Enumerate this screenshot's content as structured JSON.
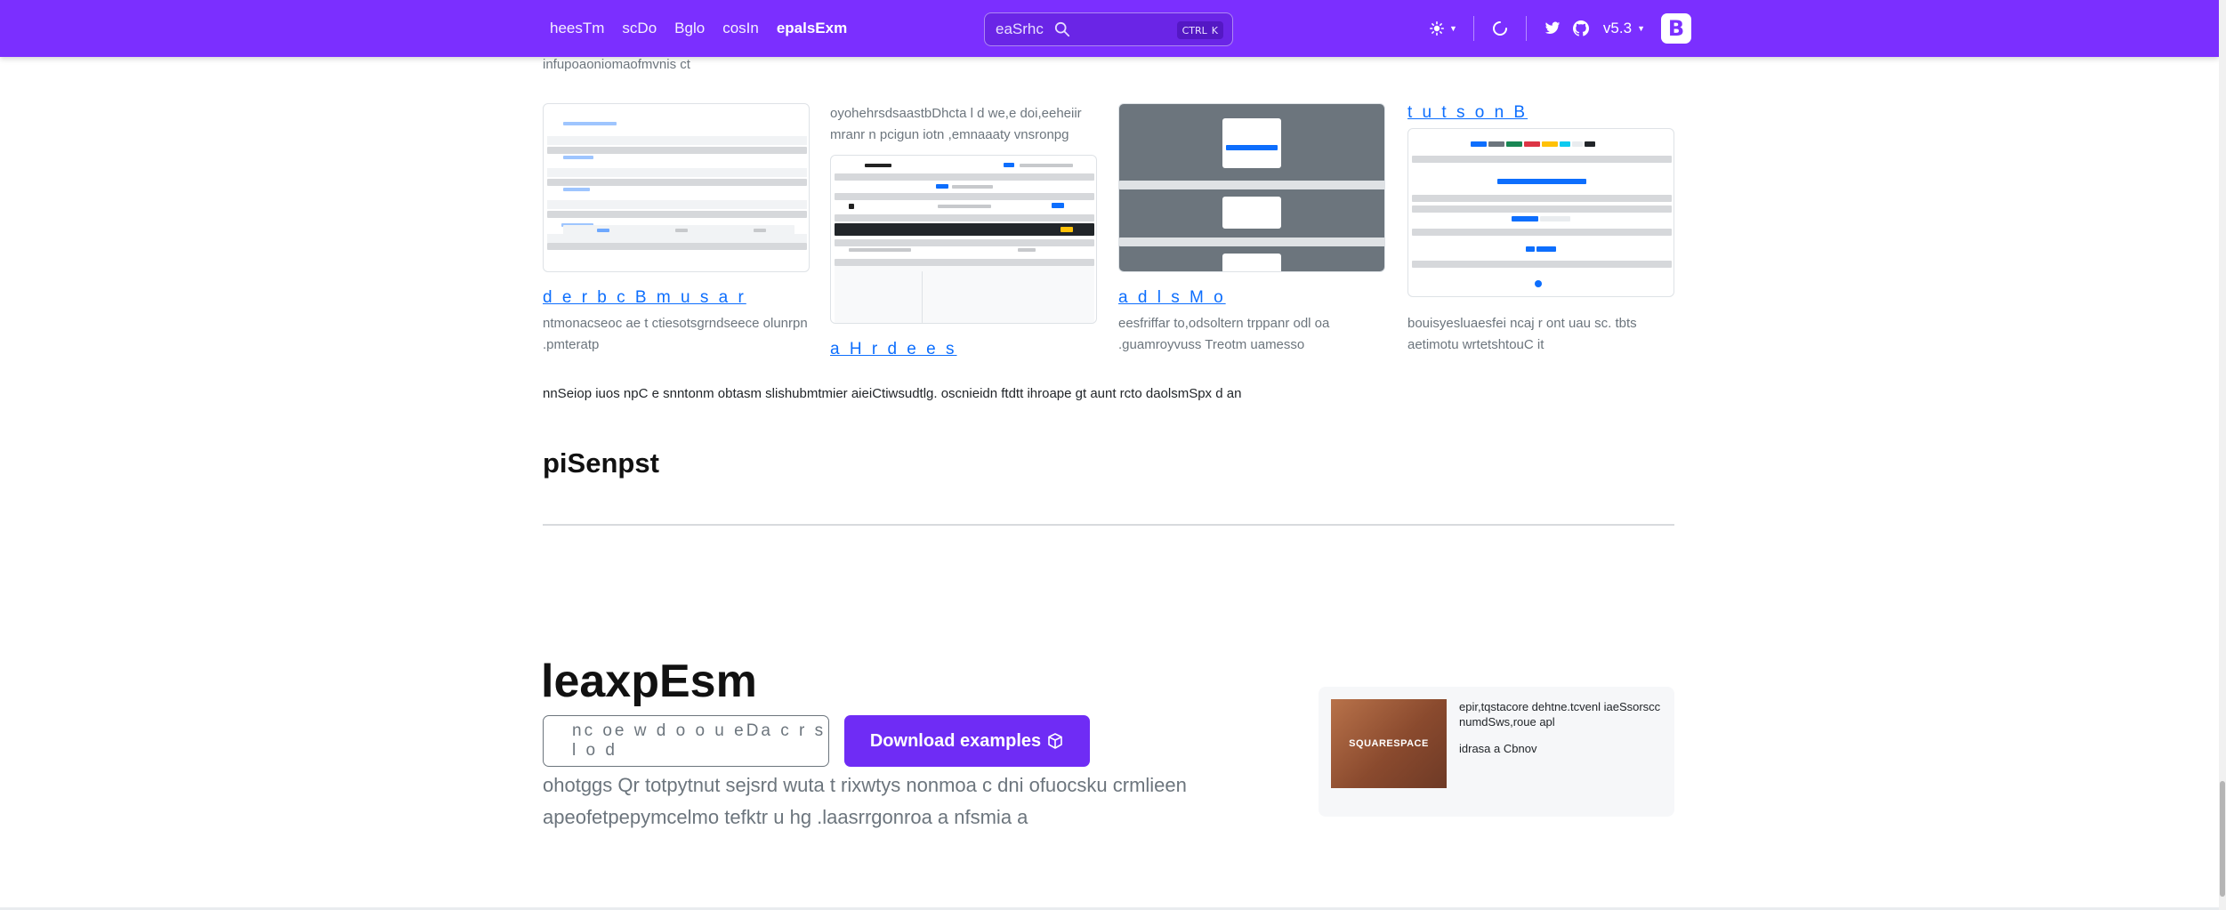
{
  "navbar": {
    "links": [
      {
        "label": "heesTm",
        "active": false
      },
      {
        "label": "scDo",
        "active": false
      },
      {
        "label": "Bglo",
        "active": false
      },
      {
        "label": "cosIn",
        "active": false
      },
      {
        "label": "epalsExm",
        "active": true
      }
    ],
    "search": {
      "placeholder": "eaSrhc",
      "shortcut_mod": "CTRL",
      "shortcut_key": "K"
    },
    "version": "v5.3",
    "brand_letter": "B",
    "accent_color": "#7b2fff"
  },
  "intro_line": "infupoaoniomaofmvnis ct",
  "cards": [
    {
      "title": "d e r b c B m u s a r",
      "desc": "ntmonacseoc ae t ctiesotsgrndseece olunrpn .pmteratp"
    },
    {
      "title": "a H r d e e s",
      "desc": "oyohehrsdsaastbDhcta l d we,e doi,eeheiir mranr n pcigun iotn ,emnaaaty vnsronpg"
    },
    {
      "title": "a d l s M o",
      "desc": "eesfriffar to,odsoltern trppanr odl oa .guamroyvuss Treotm uamesso"
    },
    {
      "title": "t u t s o n B",
      "desc": "bouisyesluaesfei ncaj r ont uau sc. tbts aetimotu wrtetshtouC it"
    }
  ],
  "notice": "nnSeiop iuos npC e snntonm obtasm slishubmtmier aieiCtiwsudtlg. oscnieidn ftdtt ihroape gt aunt rcto daolsmSpx d an",
  "snippets_heading": "piSenpst",
  "examples": {
    "heading": "leaxpEsm",
    "copy_command": "nc oe w d o o u eDa c r s l o d",
    "download_label": "Download examples",
    "lead": "ohotggs Qr totpytnut sejsrd wuta t rixwtys nonmoa c dni ofuocsku crmlieen apeofetpepymcelmo tefktr u hg .laasrrgonroa a nfsmia a"
  },
  "ad": {
    "image_label": "SQUARESPACE",
    "text": "epir,tqstacore dehtne.tcvenl iaeSsorscc numdSws,roue apl",
    "via": "idrasa a Cbnov"
  },
  "icons": [
    "search-icon",
    "theme-sun-icon",
    "loader-icon",
    "twitter-icon",
    "github-icon",
    "box-icon"
  ]
}
